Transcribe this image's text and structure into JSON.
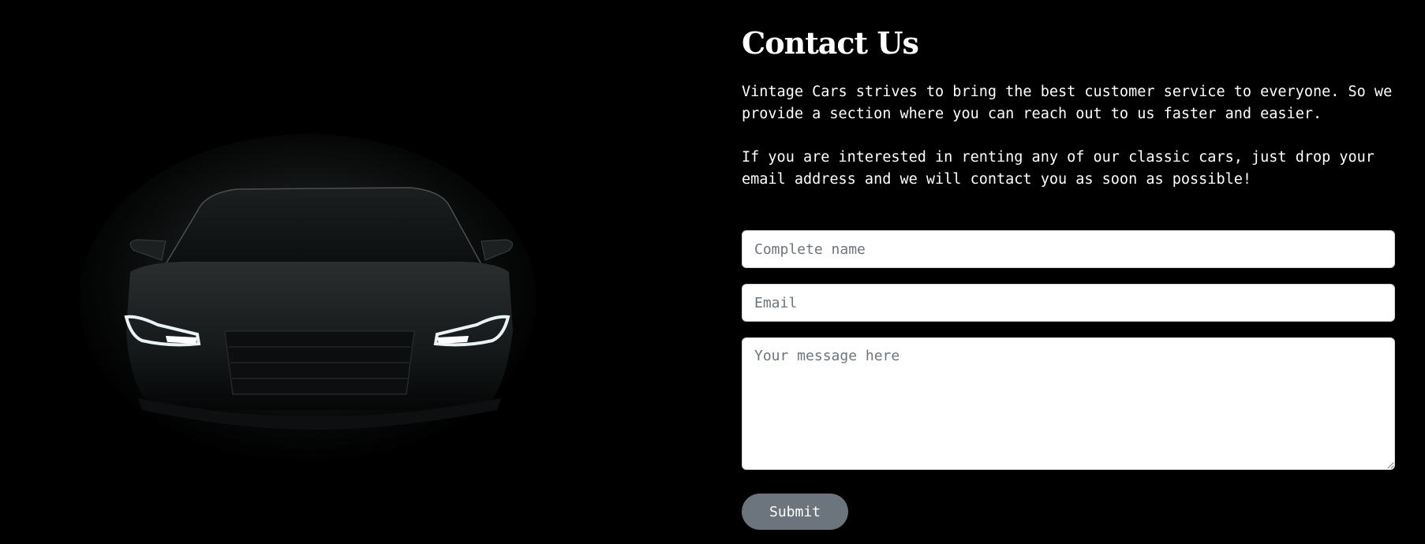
{
  "contact": {
    "title": "Contact Us",
    "paragraph_1": "Vintage Cars strives to bring the best customer service to everyone. So we provide a section where you can reach out to us faster and easier.",
    "paragraph_2": "If you are interested in renting any of our classic cars, just drop your email address and we will contact you as soon as possible!"
  },
  "form": {
    "name_placeholder": "Complete name",
    "email_placeholder": "Email",
    "message_placeholder": "Your message here",
    "submit_label": "Submit"
  },
  "colors": {
    "background": "#000000",
    "text": "#ffffff",
    "button": "#6c757d",
    "placeholder": "#6c757d"
  }
}
